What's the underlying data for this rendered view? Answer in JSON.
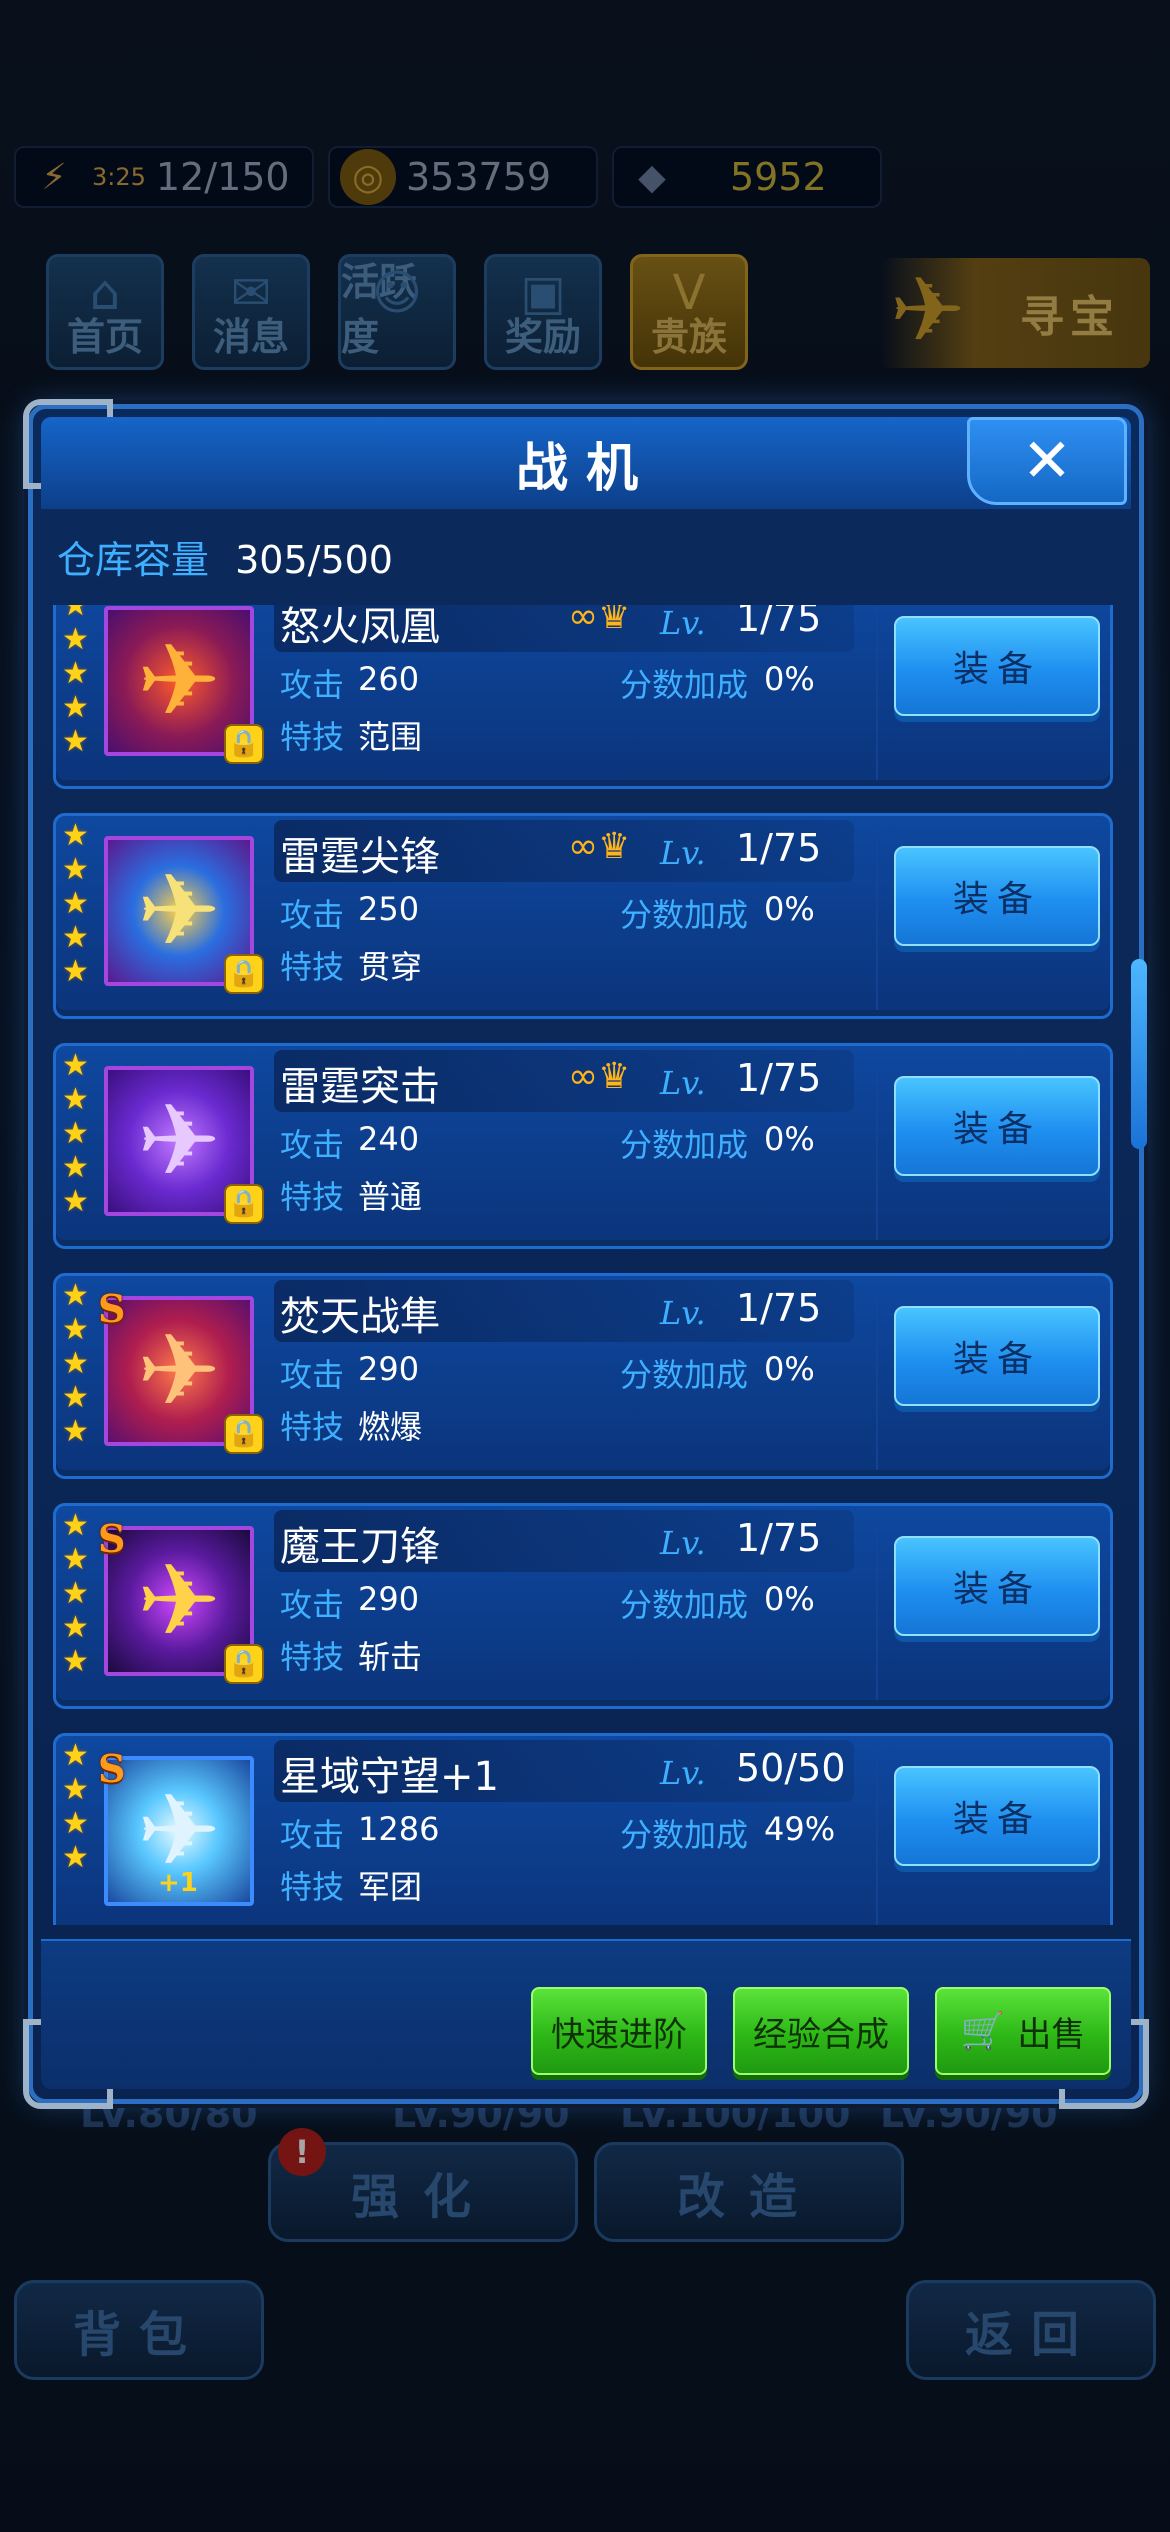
{
  "resources": {
    "energy_timer": "3:25",
    "energy": "12/150",
    "gold": "353759",
    "diamond": "5952"
  },
  "nav": [
    {
      "label": "首页",
      "icon": "home-icon"
    },
    {
      "label": "消息",
      "icon": "mail-icon"
    },
    {
      "label": "活跃度",
      "icon": "activity-icon"
    },
    {
      "label": "奖励",
      "icon": "gift-icon"
    },
    {
      "label": "贵族",
      "icon": "vip-icon"
    }
  ],
  "treasure_label": "寻宝",
  "dialog": {
    "title": "战机",
    "close_icon": "✕",
    "capacity_label": "仓库容量",
    "capacity_value": "305/500",
    "labels": {
      "lv": "Lv.",
      "attack": "攻击",
      "bonus": "分数加成",
      "skill": "特技",
      "equip": "装备"
    },
    "items": [
      {
        "name": "怒火凤凰",
        "lv": "1/75",
        "attack": "260",
        "bonus": "0%",
        "skill": "范围",
        "locked": true,
        "s_rank": false,
        "medal": true,
        "stars": 5
      },
      {
        "name": "雷霆尖锋",
        "lv": "1/75",
        "attack": "250",
        "bonus": "0%",
        "skill": "贯穿",
        "locked": true,
        "s_rank": false,
        "medal": true,
        "stars": 5
      },
      {
        "name": "雷霆突击",
        "lv": "1/75",
        "attack": "240",
        "bonus": "0%",
        "skill": "普通",
        "locked": true,
        "s_rank": false,
        "medal": true,
        "stars": 5
      },
      {
        "name": "焚天战隼",
        "lv": "1/75",
        "attack": "290",
        "bonus": "0%",
        "skill": "燃爆",
        "locked": true,
        "s_rank": true,
        "medal": false,
        "stars": 5
      },
      {
        "name": "魔王刀锋",
        "lv": "1/75",
        "attack": "290",
        "bonus": "0%",
        "skill": "斩击",
        "locked": true,
        "s_rank": true,
        "medal": false,
        "stars": 5
      },
      {
        "name": "星域守望+1",
        "lv": "50/50",
        "attack": "1286",
        "bonus": "49%",
        "skill": "军团",
        "locked": false,
        "s_rank": true,
        "medal": false,
        "stars": 4,
        "plus": "+1"
      }
    ],
    "footer": {
      "quick_advance": "快速进阶",
      "exp_merge": "经验合成",
      "sell": "出售"
    }
  },
  "background": {
    "levels": [
      "LV.80/80",
      "LV.90/90",
      "LV.100/100",
      "LV.90/90"
    ],
    "notify_badge": "!",
    "strengthen": "强化",
    "remodel": "改造",
    "bag": "背包",
    "back": "返回"
  }
}
